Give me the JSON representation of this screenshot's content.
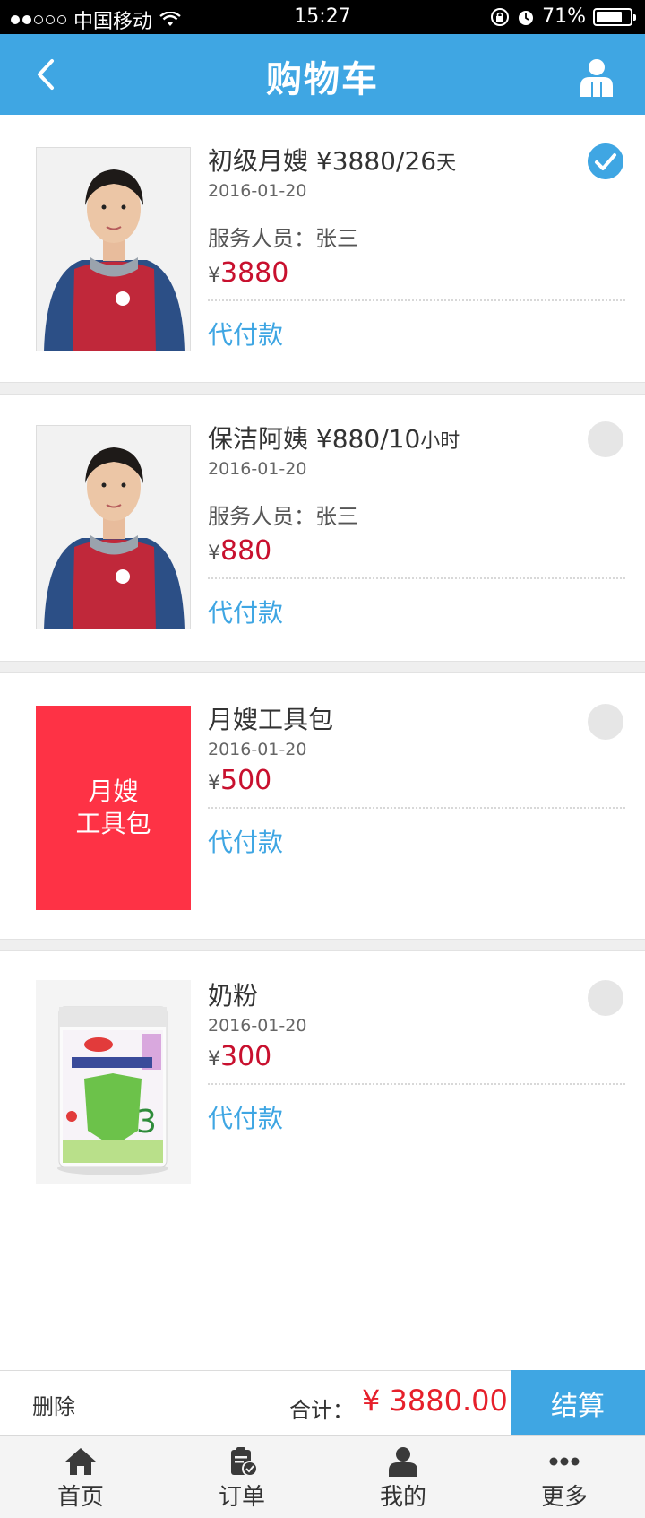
{
  "status": {
    "carrier": "中国移动",
    "time": "15:27",
    "battery": "71%",
    "battery_level": 0.71
  },
  "header": {
    "title": "购物车"
  },
  "items": [
    {
      "name": "初级月嫂",
      "price": "¥3880",
      "slash": "/",
      "duration": "26",
      "unit": "天",
      "date": "2016-01-20",
      "staff": "服务人员：张三",
      "yen": "¥",
      "amount": "3880",
      "action": "代付款",
      "selected": true,
      "image": "person-photo"
    },
    {
      "name": "保洁阿姨",
      "price": "¥880",
      "slash": "/",
      "duration": "10",
      "unit": "小时",
      "date": "2016-01-20",
      "staff": "服务人员：张三",
      "yen": "¥",
      "amount": "880",
      "action": "代付款",
      "selected": false,
      "image": "person-photo"
    },
    {
      "name": "月嫂工具包",
      "date": "2016-01-20",
      "yen": "¥",
      "amount": "500",
      "action": "代付款",
      "selected": false,
      "image_text": [
        "月嫂",
        "工具包"
      ],
      "image_color": "#fe3245"
    },
    {
      "name": "奶粉",
      "date": "2016-01-20",
      "yen": "¥",
      "amount": "300",
      "action": "代付款",
      "selected": false,
      "image": "milk-powder-can"
    }
  ],
  "bottom": {
    "delete": "删除",
    "total_label": "合计：",
    "total_value": "¥ 3880.00",
    "checkout": "结算"
  },
  "tabs": [
    {
      "label": "首页",
      "icon": "home-icon"
    },
    {
      "label": "订单",
      "icon": "order-icon"
    },
    {
      "label": "我的",
      "icon": "user-icon"
    },
    {
      "label": "更多",
      "icon": "more-icon"
    }
  ],
  "colors": {
    "accent": "#3fa6e3",
    "price": "#c8102e",
    "total": "#e6202b",
    "tool_kit": "#fe3245"
  }
}
